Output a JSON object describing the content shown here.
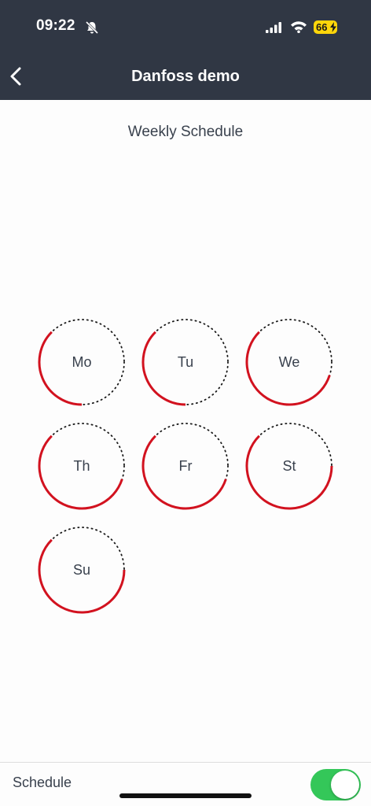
{
  "status_bar": {
    "time": "09:22",
    "battery": "66"
  },
  "nav": {
    "title": "Danfoss demo"
  },
  "page": {
    "title": "Weekly Schedule"
  },
  "days": [
    {
      "label": "Mo",
      "schedule_segments": [
        [
          0.5,
          0.875
        ]
      ]
    },
    {
      "label": "Tu",
      "schedule_segments": [
        [
          0.5,
          0.875
        ]
      ]
    },
    {
      "label": "We",
      "schedule_segments": [
        [
          0.3,
          0.875
        ]
      ]
    },
    {
      "label": "Th",
      "schedule_segments": [
        [
          0.3,
          0.875
        ]
      ]
    },
    {
      "label": "Fr",
      "schedule_segments": [
        [
          0.3,
          0.875
        ]
      ]
    },
    {
      "label": "St",
      "schedule_segments": [
        [
          0.25,
          0.875
        ]
      ]
    },
    {
      "label": "Su",
      "schedule_segments": [
        [
          0.25,
          0.875
        ]
      ]
    }
  ],
  "footer": {
    "schedule_label": "Schedule",
    "schedule_enabled": true
  },
  "colors": {
    "header_bg": "#303744",
    "schedule_on": "#d2121f",
    "schedule_off": "#1a1a1a",
    "toggle_on": "#34c759"
  }
}
